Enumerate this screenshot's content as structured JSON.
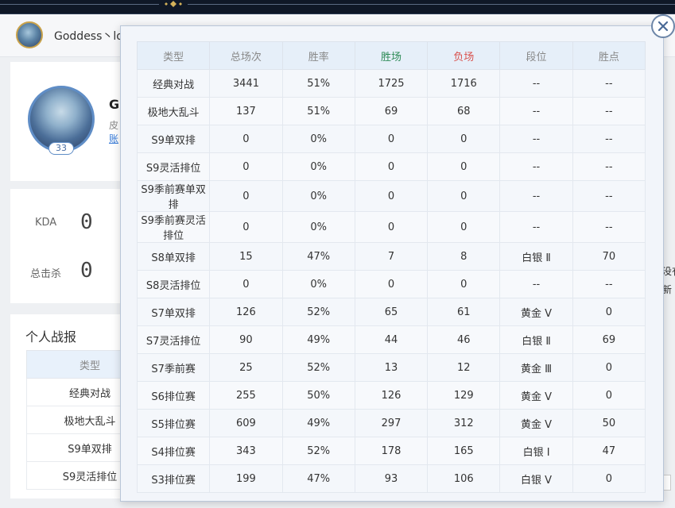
{
  "user": {
    "name": "Goddess丶los"
  },
  "profile": {
    "name": "G",
    "sub": "皮",
    "link": "账",
    "level": "33"
  },
  "stats": [
    {
      "label": "KDA",
      "value": "0"
    },
    {
      "label": "总击杀",
      "value": "0"
    }
  ],
  "report": {
    "title": "个人战报",
    "header": "类型",
    "rows": [
      "经典对战",
      "极地大乱斗",
      "S9单双排",
      "S9灵活排位"
    ]
  },
  "right_fragments": [
    "没有",
    "新"
  ],
  "modal": {
    "headers": [
      "类型",
      "总场次",
      "胜率",
      "胜场",
      "负场",
      "段位",
      "胜点"
    ],
    "header_colors": {
      "win": "#2e8b57",
      "loss": "#d9534f"
    },
    "rows": [
      [
        "经典对战",
        "3441",
        "51%",
        "1725",
        "1716",
        "--",
        "--"
      ],
      [
        "极地大乱斗",
        "137",
        "51%",
        "69",
        "68",
        "--",
        "--"
      ],
      [
        "S9单双排",
        "0",
        "0%",
        "0",
        "0",
        "--",
        "--"
      ],
      [
        "S9灵活排位",
        "0",
        "0%",
        "0",
        "0",
        "--",
        "--"
      ],
      [
        "S9季前赛单双排",
        "0",
        "0%",
        "0",
        "0",
        "--",
        "--"
      ],
      [
        "S9季前赛灵活排位",
        "0",
        "0%",
        "0",
        "0",
        "--",
        "--"
      ],
      [
        "S8单双排",
        "15",
        "47%",
        "7",
        "8",
        "白银 Ⅱ",
        "70"
      ],
      [
        "S8灵活排位",
        "0",
        "0%",
        "0",
        "0",
        "--",
        "--"
      ],
      [
        "S7单双排",
        "126",
        "52%",
        "65",
        "61",
        "黄金 Ⅴ",
        "0"
      ],
      [
        "S7灵活排位",
        "90",
        "49%",
        "44",
        "46",
        "白银 Ⅱ",
        "69"
      ],
      [
        "S7季前赛",
        "25",
        "52%",
        "13",
        "12",
        "黄金 Ⅲ",
        "0"
      ],
      [
        "S6排位赛",
        "255",
        "50%",
        "126",
        "129",
        "黄金 Ⅴ",
        "0"
      ],
      [
        "S5排位赛",
        "609",
        "49%",
        "297",
        "312",
        "黄金 Ⅴ",
        "50"
      ],
      [
        "S4排位赛",
        "343",
        "52%",
        "178",
        "165",
        "白银 Ⅰ",
        "47"
      ],
      [
        "S3排位赛",
        "199",
        "47%",
        "93",
        "106",
        "白银 Ⅴ",
        "0"
      ]
    ]
  },
  "icons": {
    "close": "close-icon"
  }
}
